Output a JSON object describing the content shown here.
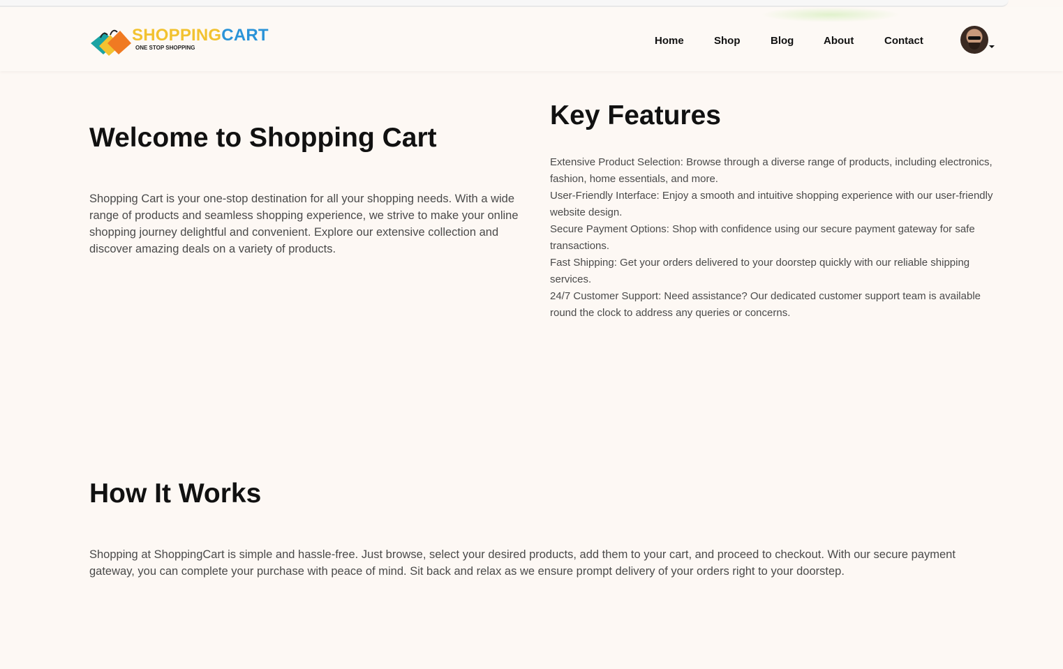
{
  "brand": {
    "name_part1": "SHOPPING",
    "name_part2": "CART",
    "tagline": "ONE STOP SHOPPING",
    "colors": {
      "yellow": "#f2c230",
      "blue": "#2a93d8",
      "orange": "#f07a22",
      "teal": "#1aa3a3"
    }
  },
  "nav": {
    "items": [
      {
        "label": "Home"
      },
      {
        "label": "Shop"
      },
      {
        "label": "Blog"
      },
      {
        "label": "About"
      },
      {
        "label": "Contact"
      }
    ],
    "avatar_icon": "user-avatar",
    "dropdown_icon": "chevron-down-icon"
  },
  "welcome": {
    "title": "Welcome to Shopping Cart",
    "text": "Shopping Cart is your one-stop destination for all your shopping needs. With a wide range of products and seamless shopping experience, we strive to make your online shopping journey delightful and convenient. Explore our extensive collection and discover amazing deals on a variety of products."
  },
  "features": {
    "title": "Key Features",
    "items": [
      "Extensive Product Selection: Browse through a diverse range of products, including electronics, fashion, home essentials, and more.",
      "User-Friendly Interface: Enjoy a smooth and intuitive shopping experience with our user-friendly website design.",
      "Secure Payment Options: Shop with confidence using our secure payment gateway for safe transactions.",
      "Fast Shipping: Get your orders delivered to your doorstep quickly with our reliable shipping services.",
      "24/7 Customer Support: Need assistance? Our dedicated customer support team is available round the clock to address any queries or concerns."
    ]
  },
  "how_it_works": {
    "title": "How It Works",
    "text": "Shopping at ShoppingCart is simple and hassle-free. Just browse, select your desired products, add them to your cart, and proceed to checkout. With our secure payment gateway, you can complete your purchase with peace of mind. Sit back and relax as we ensure prompt delivery of your orders right to your doorstep."
  }
}
